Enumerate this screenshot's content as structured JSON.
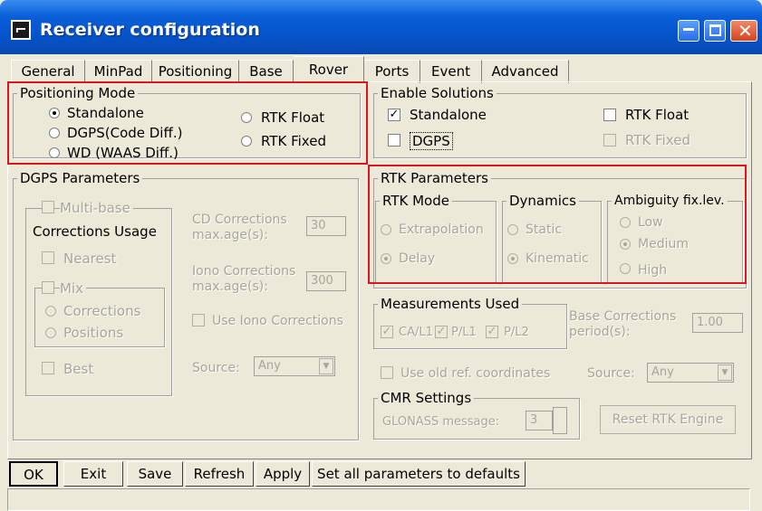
{
  "window": {
    "title": "Receiver configuration"
  },
  "tabs": [
    "General",
    "MinPad",
    "Positioning",
    "Base",
    "Rover",
    "Ports",
    "Event",
    "Advanced"
  ],
  "positioning_mode": {
    "title": "Positioning Mode",
    "standalone": "Standalone",
    "dgps": "DGPS(Code Diff.)",
    "wd": "WD (WAAS Diff.)",
    "rtk_float": "RTK Float",
    "rtk_fixed": "RTK Fixed",
    "selected": "Standalone"
  },
  "enable_solutions": {
    "title": "Enable Solutions",
    "standalone": "Standalone",
    "dgps": "DGPS",
    "rtk_float": "RTK Float",
    "rtk_fixed": "RTK Fixed",
    "checked": [
      "Standalone"
    ]
  },
  "dgps_params": {
    "title": "DGPS Parameters",
    "multi_base": "Multi-base",
    "corrections_usage": "Corrections Usage",
    "nearest": "Nearest",
    "mix": "Mix",
    "corrections": "Corrections",
    "positions": "Positions",
    "best": "Best",
    "cd_corr_label": "CD Corrections max.age(s):",
    "cd_corr_value": "30",
    "iono_corr_label": "Iono Corrections max.age(s):",
    "iono_corr_value": "300",
    "use_iono": "Use Iono Corrections",
    "source_label": "Source:",
    "source_value": "Any"
  },
  "rtk_params": {
    "title": "RTK Parameters",
    "rtk_mode": "RTK Mode",
    "extrapolation": "Extrapolation",
    "delay": "Delay",
    "dynamics": "Dynamics",
    "static": "Static",
    "kinematic": "Kinematic",
    "ambiguity": "Ambiguity fix.lev.",
    "low": "Low",
    "medium": "Medium",
    "high": "High"
  },
  "measurements": {
    "title": "Measurements Used",
    "ca_l1": "CA/L1",
    "p_l1": "P/L1",
    "p_l2": "P/L2",
    "base_corr_label": "Base Corrections period(s):",
    "base_corr_value": "1.00"
  },
  "old_ref": {
    "label": "Use old ref. coordinates",
    "source_label": "Source:",
    "source_value": "Any"
  },
  "cmr": {
    "title": "CMR Settings",
    "glonass_label": "GLONASS message:",
    "glonass_value": "3",
    "reset": "Reset RTK Engine"
  },
  "buttons": {
    "ok": "OK",
    "exit": "Exit",
    "save": "Save",
    "refresh": "Refresh",
    "apply": "Apply",
    "defaults": "Set all parameters to defaults"
  },
  "colors": {
    "title_bar": "#0552c8",
    "highlight": "#e0141e",
    "disabled_text": "#a7a69a"
  }
}
